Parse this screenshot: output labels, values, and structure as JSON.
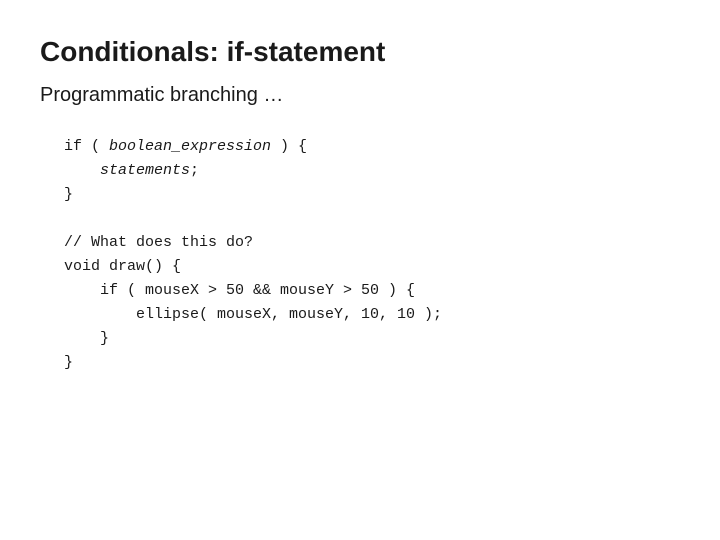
{
  "header": {
    "title": "Conditionals: if-statement"
  },
  "subtitle": "Programmatic branching …",
  "code_section1": {
    "lines": [
      "if ( boolean_expression ) {",
      "    statements;",
      "}"
    ]
  },
  "code_section2": {
    "lines": [
      "// What does this do?",
      "void draw() {",
      "    if ( mouseX > 50 && mouseY > 50 ) {",
      "        ellipse( mouseX, mouseY, 10, 10 );",
      "    }",
      "}"
    ]
  }
}
